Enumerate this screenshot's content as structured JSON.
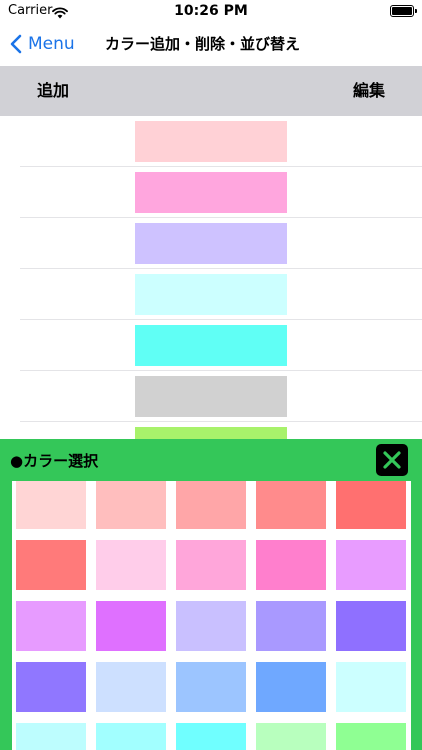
{
  "status_bar": {
    "carrier": "Carrier",
    "time": "10:26 PM"
  },
  "nav": {
    "back_label": "Menu",
    "title": "カラー追加・削除・並び替え"
  },
  "toolbar": {
    "add_label": "追加",
    "edit_label": "編集"
  },
  "list_colors": [
    "#ffd1d6",
    "#ffa6de",
    "#cec2ff",
    "#ccffff",
    "#60fff5",
    "#d1d1d1",
    "#a8f26b"
  ],
  "picker": {
    "title": "●カラー選択",
    "close_icon": "close-x-icon",
    "colors": [
      "#ffd5d5",
      "#ffbebe",
      "#ffa6a8",
      "#ff8b8c",
      "#ff7070",
      "#ff7a7a",
      "#ffcdea",
      "#ffa6da",
      "#ff7fcd",
      "#e89cff",
      "#e79bff",
      "#df70ff",
      "#c9c0ff",
      "#a999ff",
      "#8f70ff",
      "#9077ff",
      "#cde0ff",
      "#9cc5ff",
      "#6fa8ff",
      "#ccffff",
      "#bdfdfe",
      "#a2ffff",
      "#70ffff",
      "#b8ffbe",
      "#8fff93"
    ]
  },
  "accent_colors": {
    "nav_tint": "#1a73e8",
    "picker_background": "#34c759",
    "toolbar_background": "#d1d1d6"
  }
}
